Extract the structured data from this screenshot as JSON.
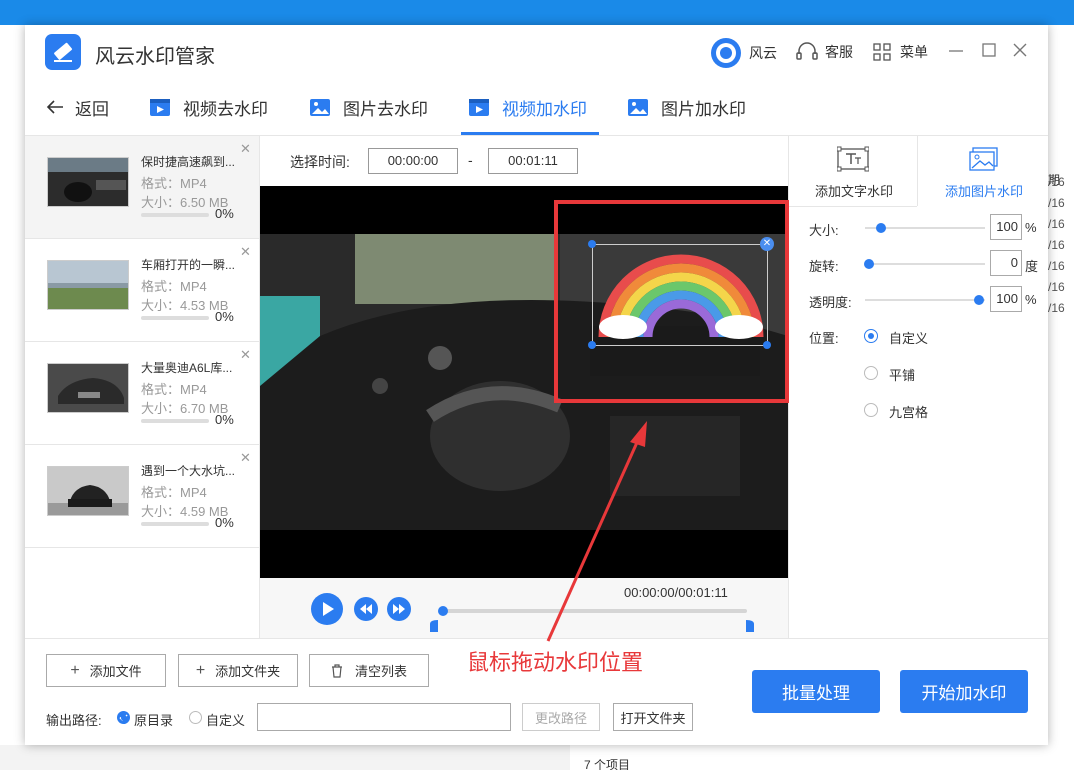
{
  "app": {
    "title": "风云水印管家",
    "user": "风云",
    "service": "客服",
    "menu": "菜单"
  },
  "nav": {
    "back": "返回",
    "tabs": [
      {
        "label": "视频去水印"
      },
      {
        "label": "图片去水印"
      },
      {
        "label": "视频加水印"
      },
      {
        "label": "图片加水印"
      }
    ]
  },
  "files": [
    {
      "name": "保时捷高速飙到...",
      "format": "格式：MP4",
      "size": "大小：6.50 MB",
      "progress": "0%"
    },
    {
      "name": "车厢打开的一瞬...",
      "format": "格式：MP4",
      "size": "大小：4.53 MB",
      "progress": "0%"
    },
    {
      "name": "大量奥迪A6L库...",
      "format": "格式：MP4",
      "size": "大小：6.70 MB",
      "progress": "0%"
    },
    {
      "name": "遇到一个大水坑...",
      "format": "格式：MP4",
      "size": "大小：4.59 MB",
      "progress": "0%"
    }
  ],
  "timing": {
    "label": "选择时间:",
    "start": "00:00:00",
    "dash": "-",
    "end": "00:01:11"
  },
  "player": {
    "timecode": "00:00:00/00:01:11"
  },
  "panel": {
    "tab_text": "添加文字水印",
    "tab_image": "添加图片水印",
    "size_label": "大小:",
    "size_value": "100",
    "size_unit": "%",
    "rotate_label": "旋转:",
    "rotate_value": "0",
    "rotate_unit": "度",
    "opacity_label": "透明度:",
    "opacity_value": "100",
    "opacity_unit": "%",
    "position_label": "位置:",
    "positions": [
      "自定义",
      "平铺",
      "九宫格"
    ]
  },
  "annotation": "鼠标拖动水印位置",
  "bottom": {
    "add_file": "添加文件",
    "add_folder": "添加文件夹",
    "clear_list": "清空列表",
    "output_label": "输出路径:",
    "opt_original": "原目录",
    "opt_custom": "自定义",
    "path_value": "",
    "change_path": "更改路径",
    "open_folder": "打开文件夹",
    "batch": "批量处理",
    "start": "开始加水印"
  },
  "desktop": {
    "header": "期",
    "dates": [
      "/16",
      "/16",
      "/16",
      "/16",
      "/16",
      "/16",
      "/16"
    ],
    "item_count": "7 个项目"
  },
  "colors": {
    "accent": "#2b7cf0",
    "annotation": "#e8383a"
  }
}
